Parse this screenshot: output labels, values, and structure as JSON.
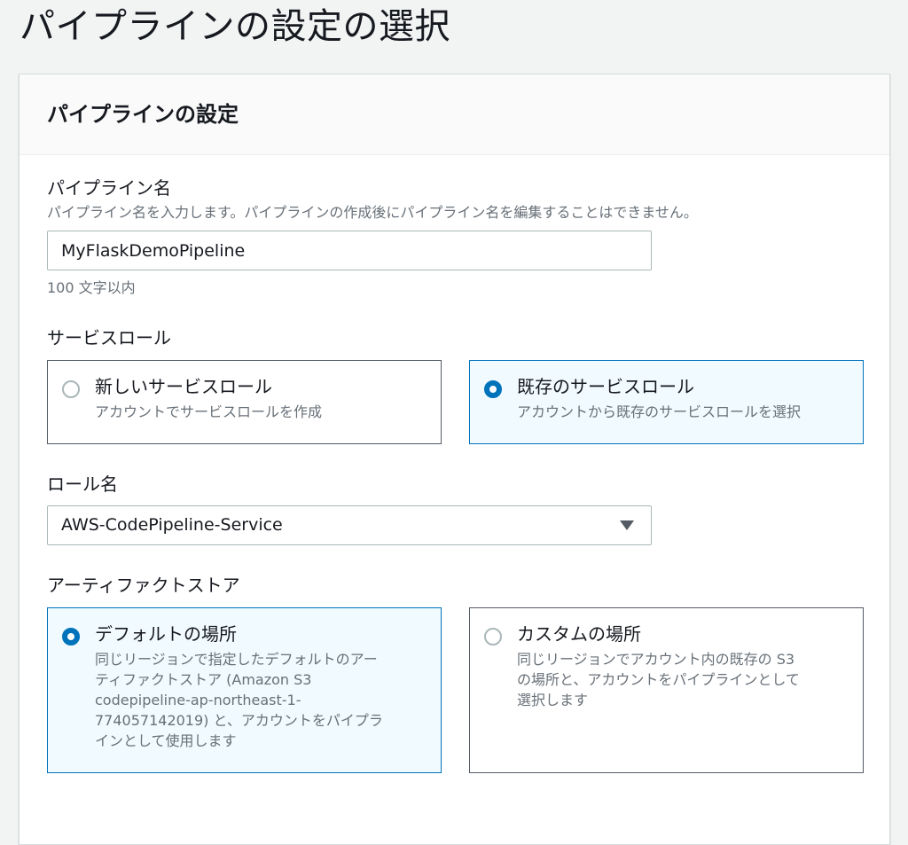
{
  "page": {
    "title": "パイプラインの設定の選択"
  },
  "panel": {
    "title": "パイプラインの設定"
  },
  "pipeline_name": {
    "label": "パイプライン名",
    "description": "パイプライン名を入力します。パイプラインの作成後にパイプライン名を編集することはできません。",
    "value": "MyFlaskDemoPipeline",
    "constraint": "100 文字以内"
  },
  "service_role": {
    "label": "サービスロール",
    "options": [
      {
        "title": "新しいサービスロール",
        "description": "アカウントでサービスロールを作成",
        "selected": false
      },
      {
        "title": "既存のサービスロール",
        "description": "アカウントから既存のサービスロールを選択",
        "selected": true
      }
    ]
  },
  "role_name": {
    "label": "ロール名",
    "value": "AWS-CodePipeline-Service"
  },
  "artifact_store": {
    "label": "アーティファクトストア",
    "options": [
      {
        "title": "デフォルトの場所",
        "description_lines": [
          "同じリージョンで指定したデフォルトのアー",
          "ティファクトストア (Amazon S3",
          "codepipeline-ap-northeast-1-",
          "774057142019) と、アカウントをパイプラ",
          "インとして使用します"
        ],
        "selected": true
      },
      {
        "title": "カスタムの場所",
        "description_lines": [
          "同じリージョンでアカウント内の既存の S3",
          "の場所と、アカウントをパイプラインとして",
          "選択します"
        ],
        "selected": false
      }
    ]
  },
  "colors": {
    "accent": "#0073bb",
    "selected_tile_bg": "#f1faff",
    "text": "#16191f",
    "muted_text": "#687078",
    "page_bg": "#f2f3f3"
  }
}
